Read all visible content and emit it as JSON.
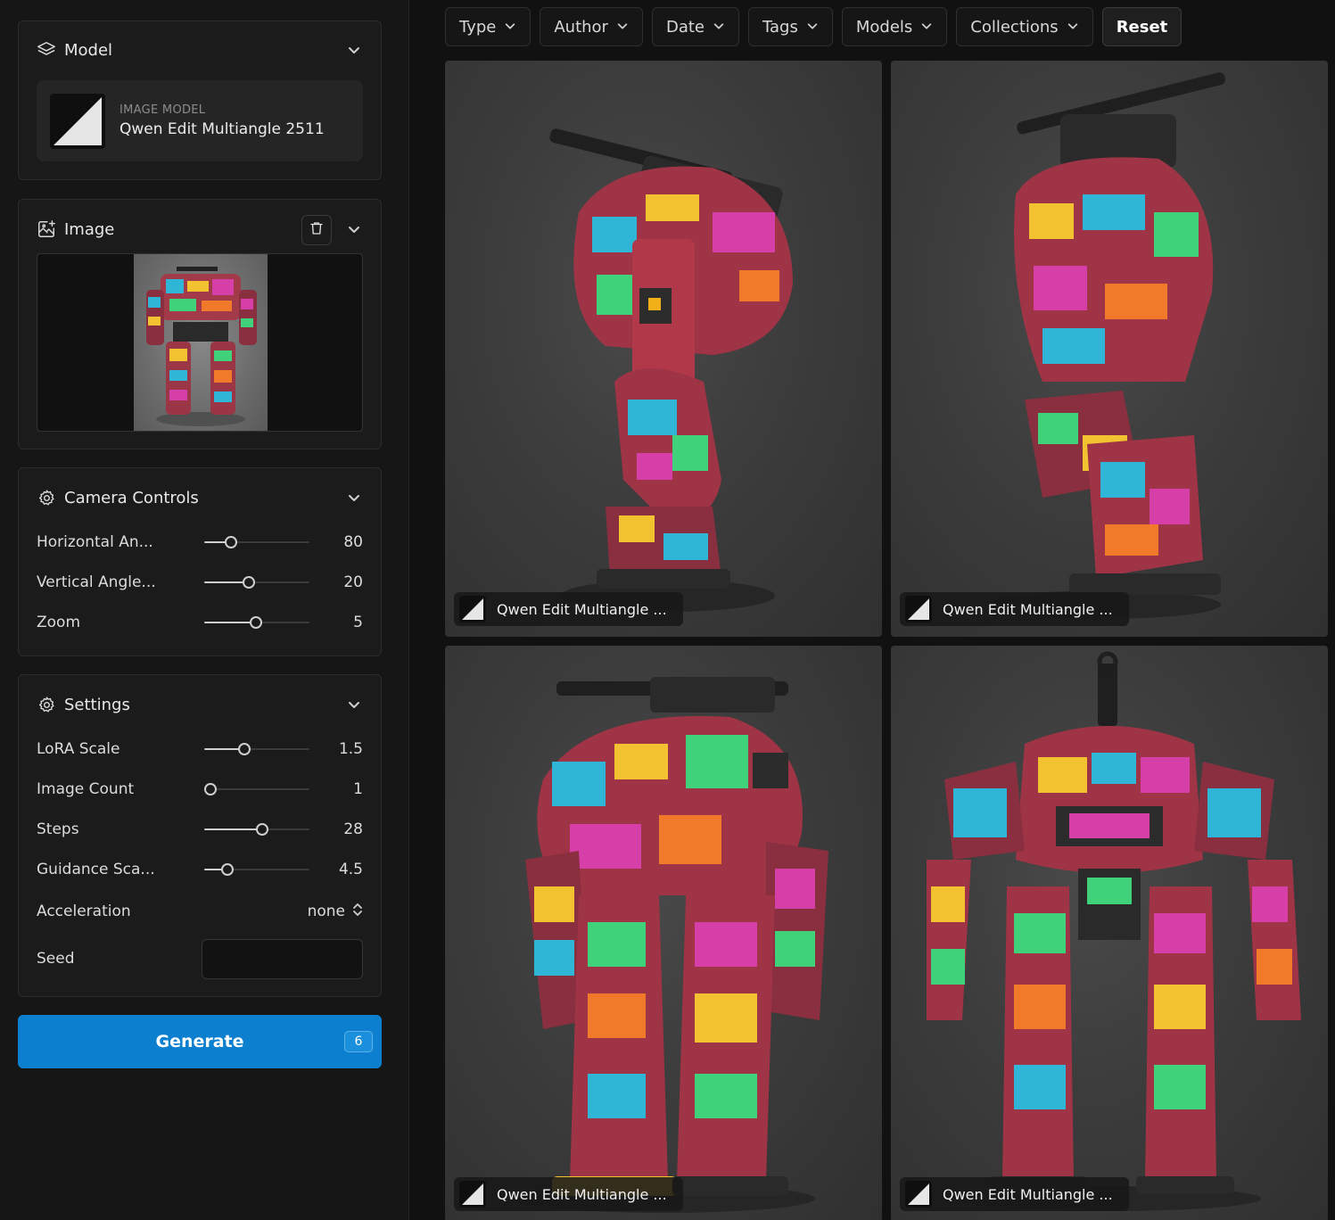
{
  "filters": [
    {
      "label": "Type"
    },
    {
      "label": "Author"
    },
    {
      "label": "Date"
    },
    {
      "label": "Tags"
    },
    {
      "label": "Models"
    },
    {
      "label": "Collections"
    }
  ],
  "reset_label": "Reset",
  "model_card": {
    "title": "Model",
    "kicker": "IMAGE MODEL",
    "name": "Qwen Edit Multiangle 2511"
  },
  "image_card": {
    "title": "Image"
  },
  "camera_controls": {
    "title": "Camera Controls",
    "rows": [
      {
        "label": "Horizontal An...",
        "value": "80",
        "fraction": 0.25
      },
      {
        "label": "Vertical Angle...",
        "value": "20",
        "fraction": 0.42
      },
      {
        "label": "Zoom",
        "value": "5",
        "fraction": 0.49
      }
    ]
  },
  "settings": {
    "title": "Settings",
    "rows": [
      {
        "label": "LoRA Scale",
        "value": "1.5",
        "fraction": 0.38
      },
      {
        "label": "Image Count",
        "value": "1",
        "fraction": 0.06
      },
      {
        "label": "Steps",
        "value": "28",
        "fraction": 0.55
      },
      {
        "label": "Guidance Sca...",
        "value": "4.5",
        "fraction": 0.22
      }
    ],
    "acceleration": {
      "label": "Acceleration",
      "value": "none"
    },
    "seed": {
      "label": "Seed",
      "value": ""
    }
  },
  "generate": {
    "label": "Generate",
    "badge": "6",
    "color": "#0c80cf"
  },
  "gallery": [
    {
      "model": "Qwen Edit Multiangle ..."
    },
    {
      "model": "Qwen Edit Multiangle ..."
    },
    {
      "model": "Qwen Edit Multiangle ..."
    },
    {
      "model": "Qwen Edit Multiangle ..."
    }
  ],
  "icons": {
    "model": "layers-icon",
    "image": "image-add-icon",
    "camera": "gear-icon",
    "settings": "gear-icon",
    "trash": "trash-icon",
    "chevron": "chevron-down-icon",
    "stepper": "up-down-chevron-icon"
  }
}
